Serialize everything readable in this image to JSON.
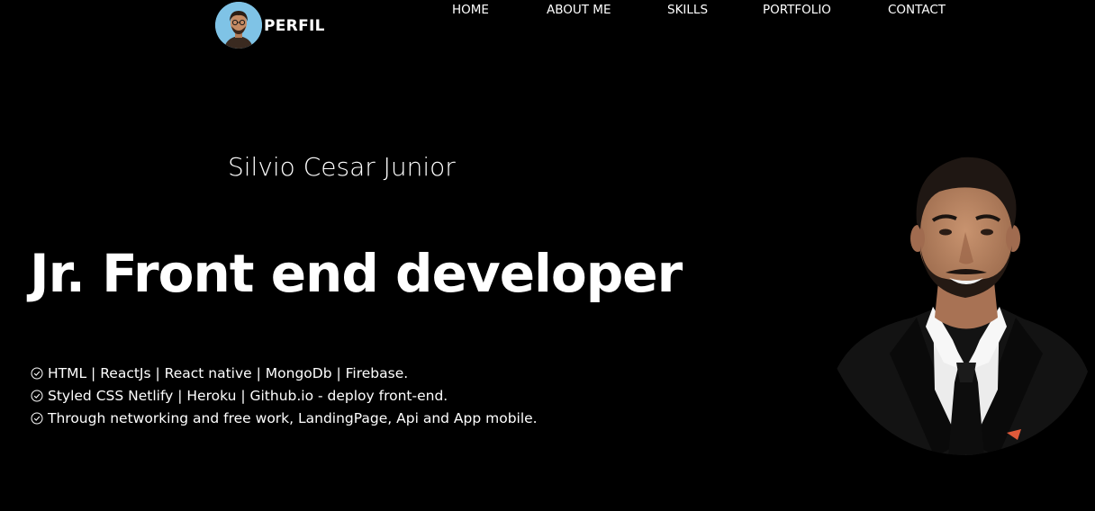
{
  "header": {
    "logo_text": "PERFIL",
    "nav": [
      {
        "label": "HOME"
      },
      {
        "label": "ABOUT ME"
      },
      {
        "label": "SKILLS"
      },
      {
        "label": "PORTFOLIO"
      },
      {
        "label": "CONTACT"
      }
    ]
  },
  "hero": {
    "name": "Silvio Cesar Junior",
    "title": "Jr. Front end developer",
    "skills": [
      {
        "text": "HTML | ReactJs | React native | MongoDb | Firebase.",
        "icon": "check-circle-icon"
      },
      {
        "text": "Styled CSS Netlify | Heroku | Github.io - deploy front-end.",
        "icon": "check-circle-icon"
      },
      {
        "text": "Through networking and free work, LandingPage, Api and App mobile.",
        "icon": "check-circle-icon"
      }
    ]
  },
  "colors": {
    "background": "#000000",
    "text": "#ffffff",
    "avatar_bg": "#7fc3e6"
  }
}
